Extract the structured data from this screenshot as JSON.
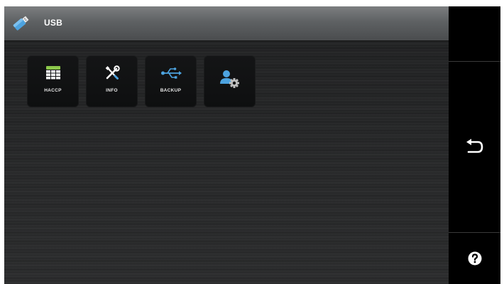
{
  "header": {
    "title": "USB",
    "icon": "usb-drive-icon"
  },
  "tiles": [
    {
      "label": "HACCP",
      "icon": "haccp-table-icon"
    },
    {
      "label": "INFO",
      "icon": "tools-icon"
    },
    {
      "label": "BACKUP",
      "icon": "usb-symbol-icon"
    },
    {
      "label": "",
      "icon": "user-settings-icon"
    }
  ],
  "sidebar": {
    "back_icon": "back-arrow-icon",
    "help_icon": "help-icon"
  },
  "colors": {
    "accent_blue": "#4da3e0",
    "haccp_green": "#8cc84b",
    "titlebar": "#5e6163",
    "background": "#222324",
    "sidebar": "#000000"
  }
}
